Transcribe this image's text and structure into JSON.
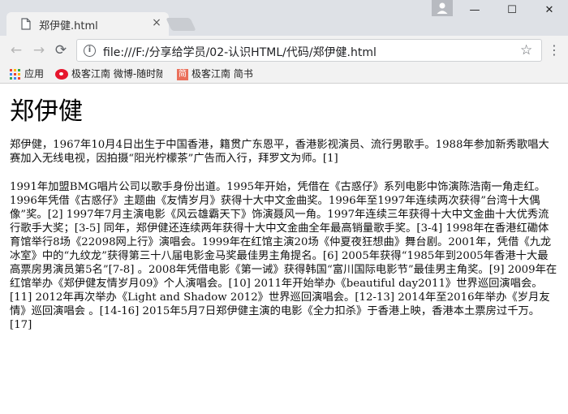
{
  "browser": {
    "tab": {
      "title": "郑伊健.html",
      "close_label": "×"
    },
    "window_controls": {
      "minimize": "—",
      "maximize": "☐",
      "close": "✕"
    },
    "url": "file:///F:/分享给学员/02-认识HTML/代码/郑伊健.html",
    "nav": {
      "back": "←",
      "forward": "→",
      "reload": "⟳"
    },
    "info_icon_label": "i",
    "star_icon": "☆",
    "menu_icon": "⋮",
    "bookmarks": [
      {
        "label": "应用",
        "icon": "apps-grid-icon"
      },
      {
        "label": "极客江南 微博-随时随",
        "icon": "weibo-icon"
      },
      {
        "label": "极客江南 简书",
        "icon": "jianshu-icon",
        "icon_text": "简"
      }
    ]
  },
  "page": {
    "title": "郑伊健",
    "paragraphs": [
      "郑伊健，1967年10月4日出生于中国香港，籍贯广东恩平，香港影视演员、流行男歌手。1988年参加新秀歌唱大赛加入无线电视，因拍摄“阳光柠檬茶”广告而入行，拜罗文为师。[1]",
      "1991年加盟BMG唱片公司以歌手身份出道。1995年开始，凭借在《古惑仔》系列电影中饰演陈浩南一角走红。1996年凭借《古惑仔》主题曲《友情岁月》获得十大中文金曲奖。1996年至1997年连续两次获得”台湾十大偶像”奖。[2] 1997年7月主演电影《风云雄霸天下》饰演聂风一角。1997年连续三年获得十大中文金曲十大优秀流行歌手大奖；[3-5] 同年，郑伊健还连续两年获得十大中文金曲全年最高销量歌手奖。[3-4] 1998年在香港红磡体育馆举行8场《22098网上行》演唱会。1999年在红馆主演20场《仲夏夜狂想曲》舞台剧。2001年，凭借《九龙冰室》中的“九纹龙”获得第三十八届电影金马奖最佳男主角提名。[6] 2005年获得“1985年到2005年香港十大最高票房男演员第5名”[7-8] 。2008年凭借电影《第一诫》获得韩国“富川国际电影节”最佳男主角奖。[9] 2009年在红馆举办《郑伊健友情岁月09》个人演唱会。[10] 2011年开始举办《beautiful day2011》世界巡回演唱会。[11] 2012年再次举办《Light and Shadow 2012》世界巡回演唱会。[12-13] 2014年至2016年举办《岁月友情》巡回演唱会 。[14-16] 2015年5月7日郑伊健主演的电影《全力扣杀》于香港上映，香港本土票房过千万。[17]"
    ]
  },
  "colors": {
    "titlebar": "#dee1e6",
    "toolbar": "#f2f2f2",
    "apps_dots": [
      "#ea4335",
      "#fbbc05",
      "#34a853",
      "#4285f4",
      "#ea4335",
      "#fbbc05",
      "#34a853",
      "#4285f4",
      "#ea4335"
    ]
  }
}
